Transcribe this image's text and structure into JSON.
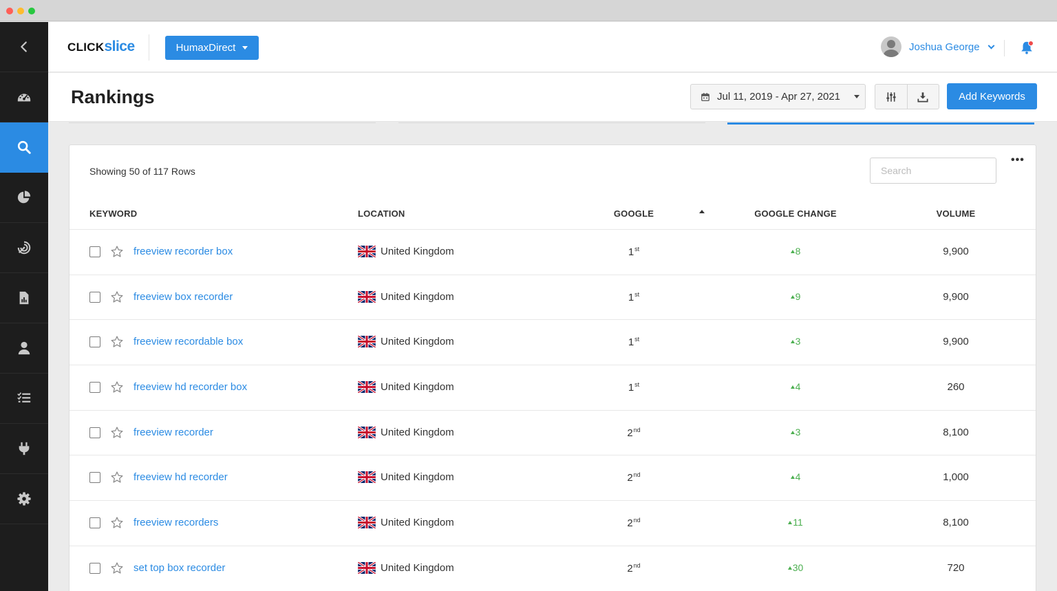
{
  "header": {
    "logo_click": "CLICK",
    "logo_slice": "slice",
    "client_name": "HumaxDirect",
    "user_name": "Joshua George"
  },
  "sidebar": {
    "items": [
      {
        "icon": "back-icon",
        "active": false
      },
      {
        "icon": "dashboard-icon",
        "active": false
      },
      {
        "icon": "search-icon",
        "active": true
      },
      {
        "icon": "pie-chart-icon",
        "active": false
      },
      {
        "icon": "target-icon",
        "active": false
      },
      {
        "icon": "report-icon",
        "active": false
      },
      {
        "icon": "user-icon",
        "active": false
      },
      {
        "icon": "list-icon",
        "active": false
      },
      {
        "icon": "plug-icon",
        "active": false
      },
      {
        "icon": "gear-icon",
        "active": false
      }
    ]
  },
  "toolbar": {
    "page_title": "Rankings",
    "date_range": "Jul 11, 2019 - Apr 27, 2021",
    "add_keywords_label": "Add Keywords"
  },
  "table": {
    "showing_text": "Showing 50 of 117 Rows",
    "search_placeholder": "Search",
    "columns": {
      "keyword": "KEYWORD",
      "location": "LOCATION",
      "google": "GOOGLE",
      "google_change": "GOOGLE CHANGE",
      "volume": "VOLUME"
    },
    "rows": [
      {
        "keyword": "freeview recorder box",
        "location": "United Kingdom",
        "rank": "1",
        "suffix": "st",
        "change": "8",
        "volume": "9,900"
      },
      {
        "keyword": "freeview box recorder",
        "location": "United Kingdom",
        "rank": "1",
        "suffix": "st",
        "change": "9",
        "volume": "9,900"
      },
      {
        "keyword": "freeview recordable box",
        "location": "United Kingdom",
        "rank": "1",
        "suffix": "st",
        "change": "3",
        "volume": "9,900"
      },
      {
        "keyword": "freeview hd recorder box",
        "location": "United Kingdom",
        "rank": "1",
        "suffix": "st",
        "change": "4",
        "volume": "260"
      },
      {
        "keyword": "freeview recorder",
        "location": "United Kingdom",
        "rank": "2",
        "suffix": "nd",
        "change": "3",
        "volume": "8,100"
      },
      {
        "keyword": "freeview hd recorder",
        "location": "United Kingdom",
        "rank": "2",
        "suffix": "nd",
        "change": "4",
        "volume": "1,000"
      },
      {
        "keyword": "freeview recorders",
        "location": "United Kingdom",
        "rank": "2",
        "suffix": "nd",
        "change": "11",
        "volume": "8,100"
      },
      {
        "keyword": "set top box recorder",
        "location": "United Kingdom",
        "rank": "2",
        "suffix": "nd",
        "change": "30",
        "volume": "720"
      }
    ]
  },
  "colors": {
    "accent": "#2b8be3",
    "sidebar_bg": "#1d1d1d",
    "positive_change": "#4caf50",
    "notification_dot": "#ef4b4b"
  }
}
